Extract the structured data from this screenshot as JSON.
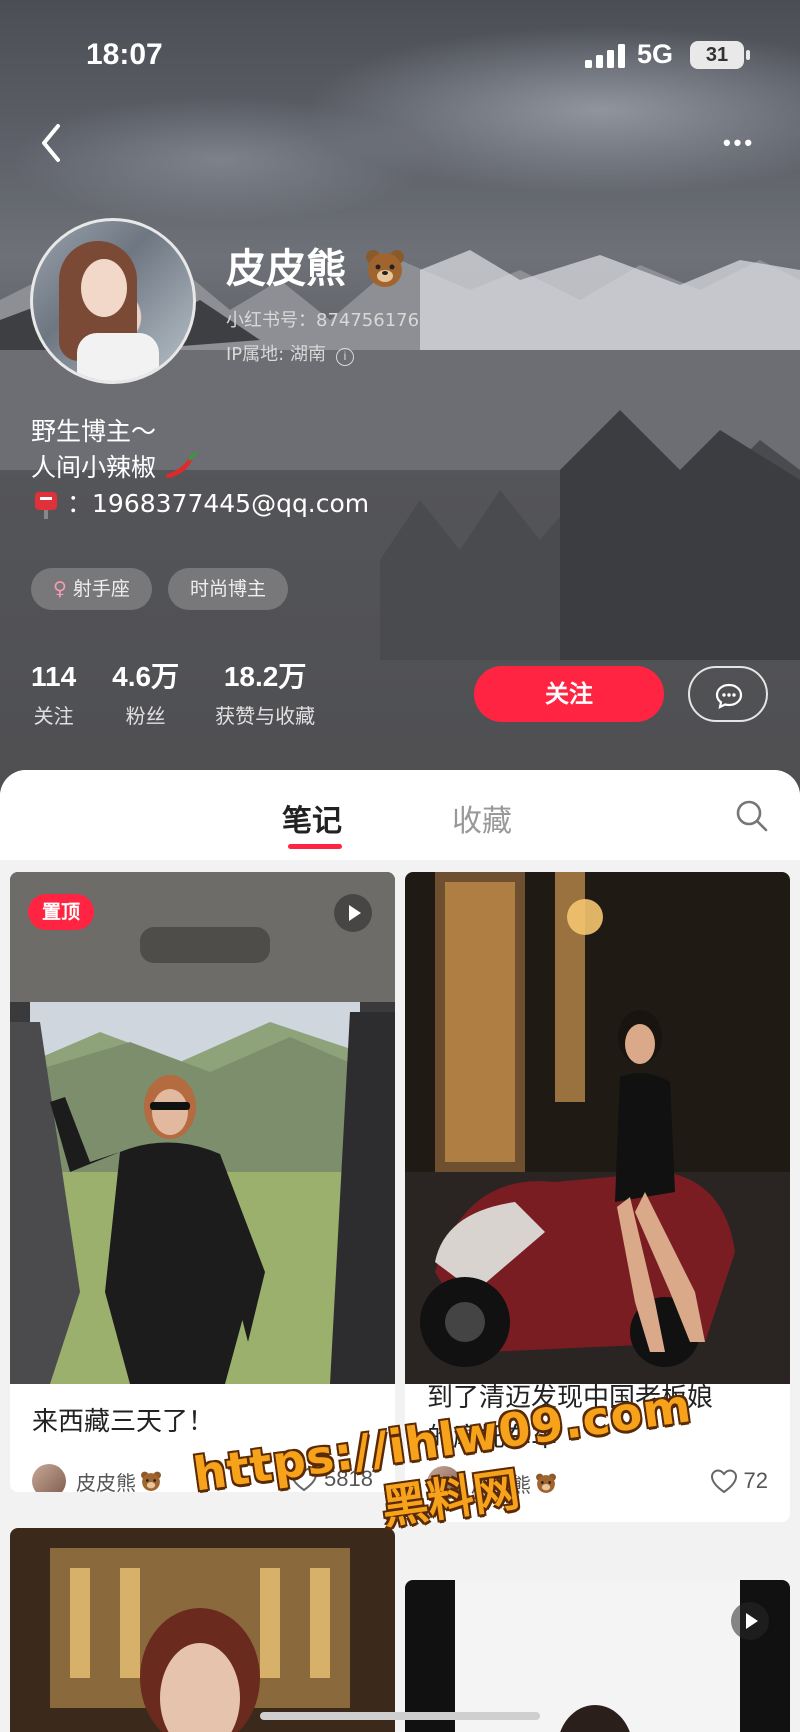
{
  "status_bar": {
    "time": "18:07",
    "network": "5G",
    "battery": "31"
  },
  "profile": {
    "nickname": "皮皮熊",
    "red_id": "小红书号：874756176",
    "ip_location": "IP属地: 湖南",
    "bio_lines": [
      "野生博主～",
      "人间小辣椒"
    ],
    "email_label": "：",
    "email": "1968377445@qq.com",
    "tags": [
      "射手座",
      "时尚博主"
    ],
    "stats": [
      {
        "value": "114",
        "label": "关注"
      },
      {
        "value": "4.6万",
        "label": "粉丝"
      },
      {
        "value": "18.2万",
        "label": "获赞与收藏"
      }
    ],
    "follow_label": "关注"
  },
  "tabs": {
    "notes": "笔记",
    "collections": "收藏"
  },
  "notes": [
    {
      "pin_label": "置顶",
      "title": "来西藏三天了！",
      "author": "皮皮熊",
      "likes": "5818"
    },
    {
      "title_line1": "到了清迈发现中国老板娘",
      "title_line2": "的摩托车车",
      "author": "皮皮熊",
      "likes": "72"
    }
  ],
  "watermark": {
    "url": "https://ihlw09.com",
    "brand": "黑料网"
  },
  "colors": {
    "accent": "#ff2442",
    "watermark": "#f7a21b"
  }
}
